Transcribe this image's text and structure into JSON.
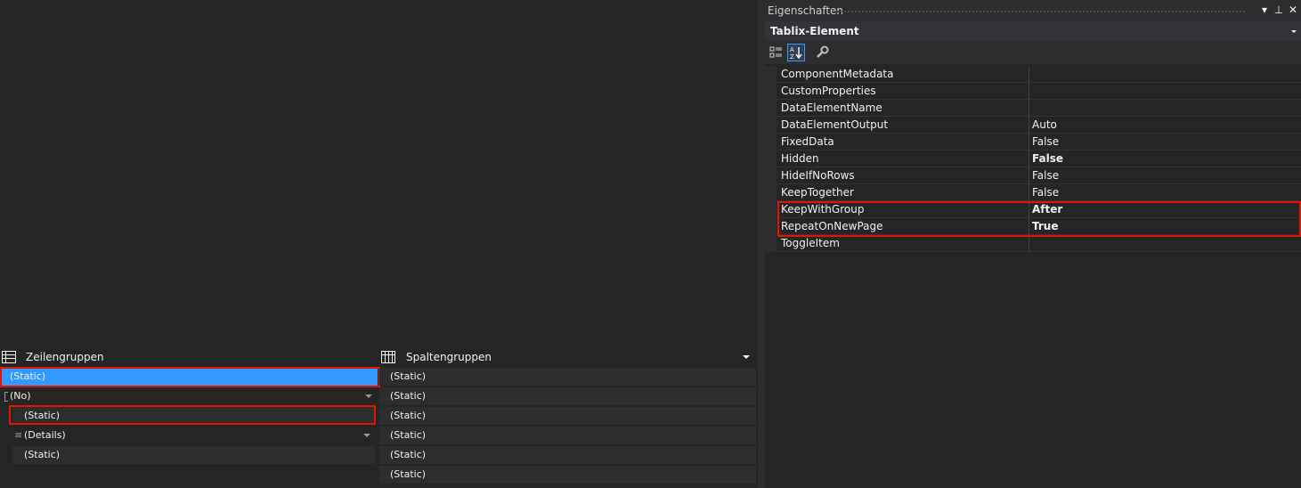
{
  "grouping": {
    "row_groups_title": "Zeilengruppen",
    "column_groups_title": "Spaltengruppen",
    "row_groups": [
      {
        "label": "(Static)",
        "selected": true,
        "highlighted": true
      },
      {
        "label": "(No)",
        "dropdown": true
      },
      {
        "label": "(Static)",
        "highlighted": true
      },
      {
        "label": "(Details)",
        "dropdown": true
      },
      {
        "label": "(Static)"
      }
    ],
    "column_groups": [
      {
        "label": "(Static)"
      },
      {
        "label": "(Static)"
      },
      {
        "label": "(Static)"
      },
      {
        "label": "(Static)"
      },
      {
        "label": "(Static)"
      },
      {
        "label": "(Static)"
      }
    ]
  },
  "properties": {
    "window_title": "Eigenschaften",
    "object_name": "Tablix-Element",
    "rows": [
      {
        "name": "ComponentMetadata",
        "value": ""
      },
      {
        "name": "CustomProperties",
        "value": ""
      },
      {
        "name": "DataElementName",
        "value": ""
      },
      {
        "name": "DataElementOutput",
        "value": "Auto"
      },
      {
        "name": "FixedData",
        "value": "False"
      },
      {
        "name": "Hidden",
        "value": "False",
        "bold": true
      },
      {
        "name": "HideIfNoRows",
        "value": "False"
      },
      {
        "name": "KeepTogether",
        "value": "False"
      },
      {
        "name": "KeepWithGroup",
        "value": "After",
        "bold": true,
        "highlighted": true
      },
      {
        "name": "RepeatOnNewPage",
        "value": "True",
        "bold": true,
        "highlighted": true
      },
      {
        "name": "ToggleItem",
        "value": ""
      }
    ]
  },
  "colors": {
    "accent": "#3399ff",
    "highlight_border": "#e51400",
    "background": "#252526"
  }
}
